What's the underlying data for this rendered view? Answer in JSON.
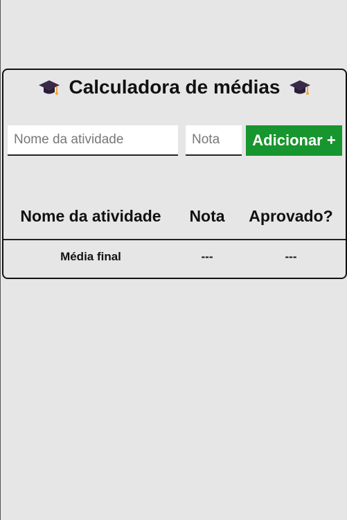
{
  "header": {
    "title": "Calculadora de médias",
    "left_icon": "graduation-cap-icon",
    "right_icon": "graduation-cap-icon"
  },
  "form": {
    "activity_placeholder": "Nome da atividade",
    "activity_value": "",
    "grade_placeholder": "Nota",
    "grade_value": "",
    "add_button_label": "Adicionar +"
  },
  "table": {
    "headers": [
      "Nome da atividade",
      "Nota",
      "Aprovado?"
    ],
    "footer": {
      "label": "Média final",
      "grade": "---",
      "approved": "---"
    }
  },
  "colors": {
    "background": "#e6e6e6",
    "button": "#17952e",
    "cap": "#3a2a4a",
    "tassel": "#f0a830"
  }
}
